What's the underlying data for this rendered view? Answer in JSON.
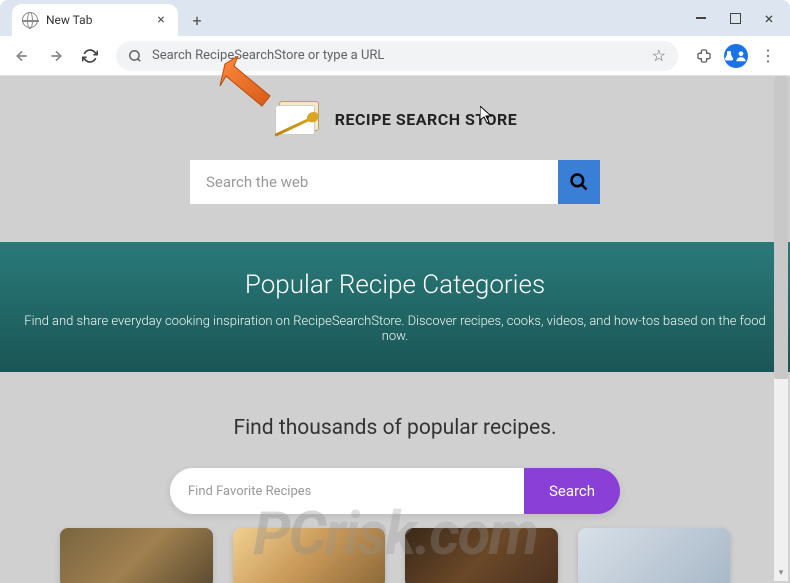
{
  "browser": {
    "tab_title": "New Tab",
    "omnibox_placeholder": "Search RecipeSearchStore or type a URL"
  },
  "page": {
    "logo_text": "RECIPE SEARCH STORE",
    "search1_placeholder": "Search the web",
    "banner_title": "Popular Recipe Categories",
    "banner_subtitle": "Find and share everyday cooking inspiration on RecipeSearchStore. Discover recipes, cooks, videos, and how-tos based on the food now.",
    "recipes_heading": "Find thousands of popular recipes.",
    "search2_placeholder": "Find Favorite Recipes",
    "search2_button": "Search"
  },
  "watermark": {
    "part1": "PC",
    "part2": "risk.com"
  }
}
